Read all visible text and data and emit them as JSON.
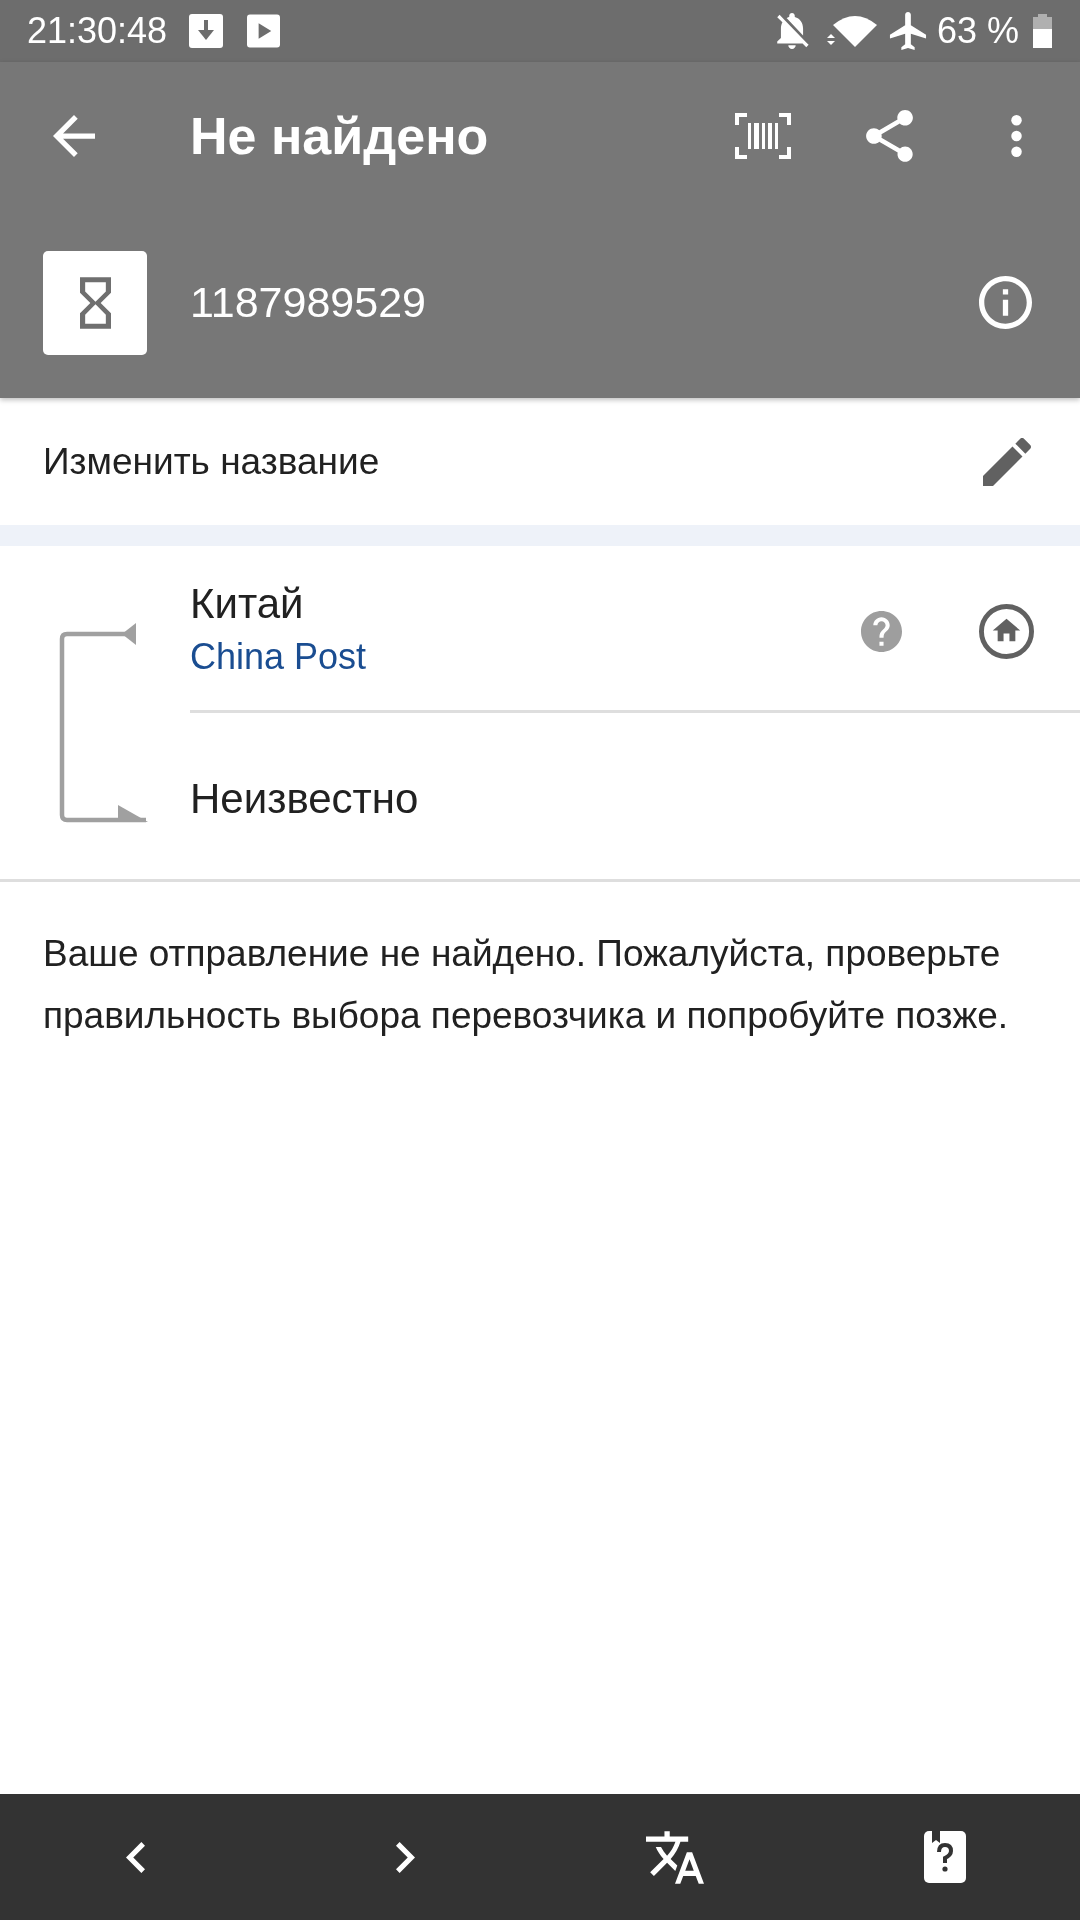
{
  "status_bar": {
    "time": "21:30:48",
    "battery": "63 %"
  },
  "app_bar": {
    "title": "Не найдено"
  },
  "parcel": {
    "tracking_number": "1187989529"
  },
  "rename": {
    "label": "Изменить название"
  },
  "route": {
    "origin": {
      "country": "Китай",
      "carrier": "China Post"
    },
    "destination": {
      "country": "Неизвестно"
    }
  },
  "message": "Ваше отправление не найдено. Пожалуйста, проверьте правильность выбора перевозчика и попробуйте позже."
}
